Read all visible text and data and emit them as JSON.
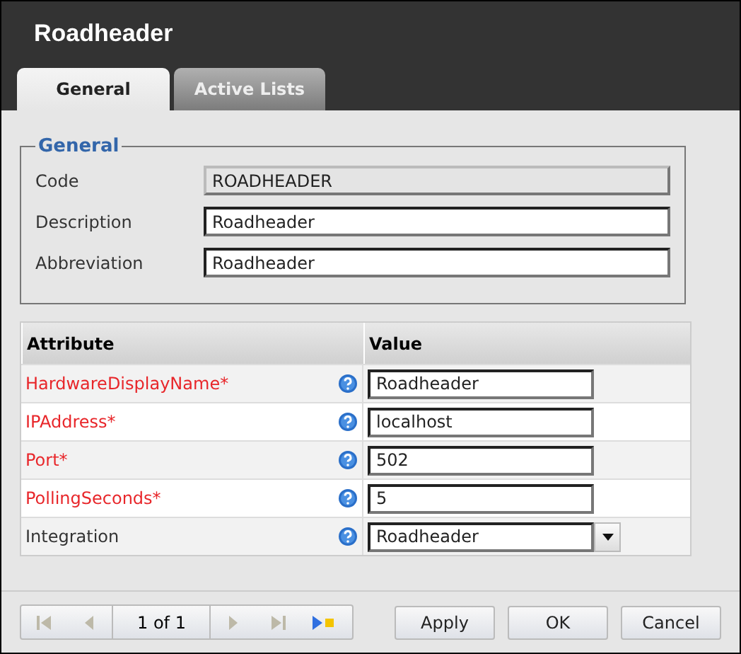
{
  "window": {
    "title": "Roadheader"
  },
  "tabs": [
    {
      "label": "General",
      "selected": true
    },
    {
      "label": "Active Lists",
      "selected": false
    }
  ],
  "general": {
    "legend": "General",
    "fields": [
      {
        "label": "Code",
        "value": "ROADHEADER",
        "disabled": true
      },
      {
        "label": "Description",
        "value": "Roadheader",
        "disabled": false
      },
      {
        "label": "Abbreviation",
        "value": "Roadheader",
        "disabled": false
      }
    ]
  },
  "table": {
    "columns": [
      "Attribute",
      "Value"
    ],
    "rows": [
      {
        "attribute": "HardwareDisplayName*",
        "required": true,
        "kind": "text",
        "value": "Roadheader"
      },
      {
        "attribute": "IPAddress*",
        "required": true,
        "kind": "text",
        "value": "localhost"
      },
      {
        "attribute": "Port*",
        "required": true,
        "kind": "text",
        "value": "502"
      },
      {
        "attribute": "PollingSeconds*",
        "required": true,
        "kind": "text",
        "value": "5"
      },
      {
        "attribute": "Integration",
        "required": false,
        "kind": "dropdown",
        "value": "Roadheader"
      }
    ]
  },
  "pager": {
    "page": "1 of 1",
    "nav": [
      {
        "kind": "first",
        "disabled": true
      },
      {
        "kind": "prev",
        "disabled": true
      },
      {
        "kind": "page"
      },
      {
        "kind": "next",
        "disabled": true
      },
      {
        "kind": "last",
        "disabled": true
      },
      {
        "kind": "new",
        "disabled": false
      }
    ]
  },
  "buttons": [
    "Apply",
    "OK",
    "Cancel"
  ]
}
